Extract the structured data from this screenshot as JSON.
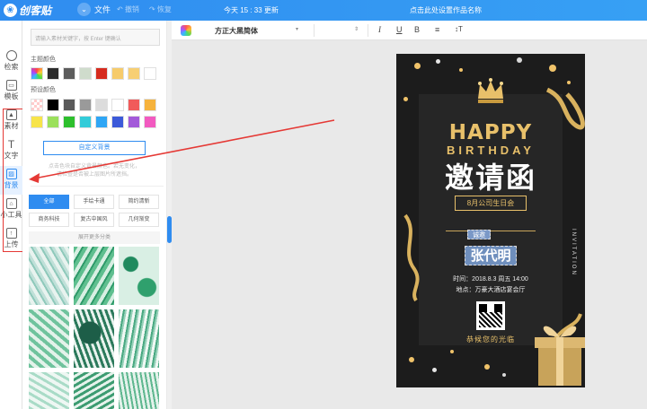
{
  "header": {
    "logo_text": "创客贴",
    "file_label": "文件",
    "undo_label": "撤销",
    "redo_label": "恢复",
    "save_status": "今天 15 : 33 更新",
    "doc_title_placeholder": "点击此处设置作品名称"
  },
  "leftnav": {
    "items": [
      {
        "label": "检索",
        "icon": "search-icon"
      },
      {
        "label": "模板",
        "icon": "template-icon"
      },
      {
        "label": "素材",
        "icon": "image-icon"
      },
      {
        "label": "文字",
        "icon": "text-icon"
      },
      {
        "label": "背景",
        "icon": "background-icon"
      },
      {
        "label": "小工具",
        "icon": "tools-icon"
      },
      {
        "label": "上传",
        "icon": "upload-icon"
      }
    ],
    "active": "背景"
  },
  "panel": {
    "search_placeholder": "请输入素材关键字，按 Enter 键确认",
    "theme_colors_label": "主题颜色",
    "theme_colors": [
      "#rainbow",
      "#2b2b2b",
      "#5c5c5c",
      "#cfdccc",
      "#d62b1e",
      "#f6cb6b",
      "#f7cf73",
      "#ffffff"
    ],
    "preset_colors_label": "预设颜色",
    "preset_colors": [
      "#transparent",
      "#000000",
      "#5a5a5a",
      "#9a9a9a",
      "#dcdcdc",
      "#ffffff",
      "#f15a5a",
      "#f6b33d",
      "#f7e44a",
      "#9be05c",
      "#2dbf2d",
      "#33ccd9",
      "#2fa6f5",
      "#3c5ad9",
      "#a35ad9",
      "#f25ac0"
    ],
    "custom_bg_label": "自定义背景",
    "tip_line1": "点击色块自定义背景颜色。若无变化，",
    "tip_line2": "请检查是否被上层图片所遮挡。",
    "tags": [
      "全部",
      "手绘卡通",
      "简约清新",
      "商务科技",
      "复古中国风",
      "几何渐变"
    ],
    "active_tag": "全部",
    "expand_label": "展开更多分类"
  },
  "toolbar": {
    "font_name": "方正大黑简体",
    "bold": "B",
    "italic": "I",
    "underline": "U",
    "align_icon": "align-center-icon",
    "spacing_icon": "letter-spacing-icon"
  },
  "poster": {
    "happy": "HAPPY",
    "birthday": "BIRTHDAY",
    "invite": "邀请函",
    "party": "8月公司生日会",
    "cheng": "诚邀",
    "name": "张代明",
    "time": "时间：2018.8.3 周五 14:00",
    "place": "地点：万豪大酒店宴会厅",
    "welcome": "恭候您的光临",
    "vertical": "INVITATION"
  },
  "colors": {
    "brand": "#2f8cf0",
    "gold": "#e8c06a",
    "annotation": "#e53935"
  }
}
